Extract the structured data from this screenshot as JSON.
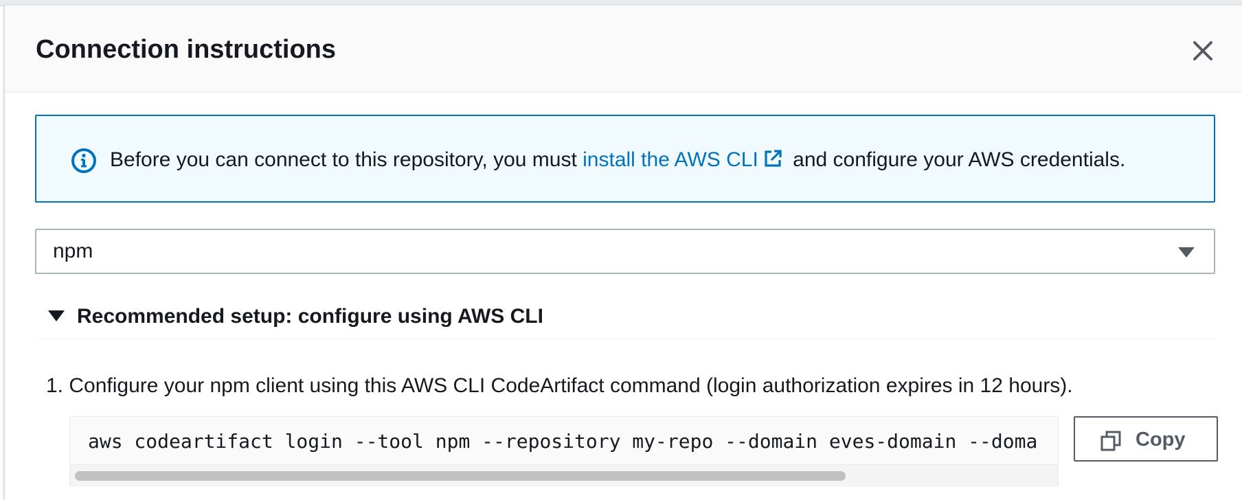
{
  "modal": {
    "title": "Connection instructions",
    "close_icon": "close-icon"
  },
  "info": {
    "icon": "info-icon",
    "text_before": "Before you can connect to this repository, you must",
    "link_text": "install the AWS CLI",
    "link_icon": "external-link-icon",
    "text_after": "and configure your AWS credentials.",
    "accent_color": "#0073bb"
  },
  "package_select": {
    "selected": "npm",
    "caret_icon": "caret-down-icon"
  },
  "expander": {
    "label": "Recommended setup: configure using AWS CLI",
    "expanded": true
  },
  "steps": [
    {
      "number": "1.",
      "text": "Configure your npm client using this AWS CLI CodeArtifact command (login authorization expires in 12 hours).",
      "command": "aws codeartifact login --tool npm --repository my-repo --domain eves-domain --doma",
      "copy_label": "Copy",
      "copy_icon": "copy-icon"
    }
  ]
}
